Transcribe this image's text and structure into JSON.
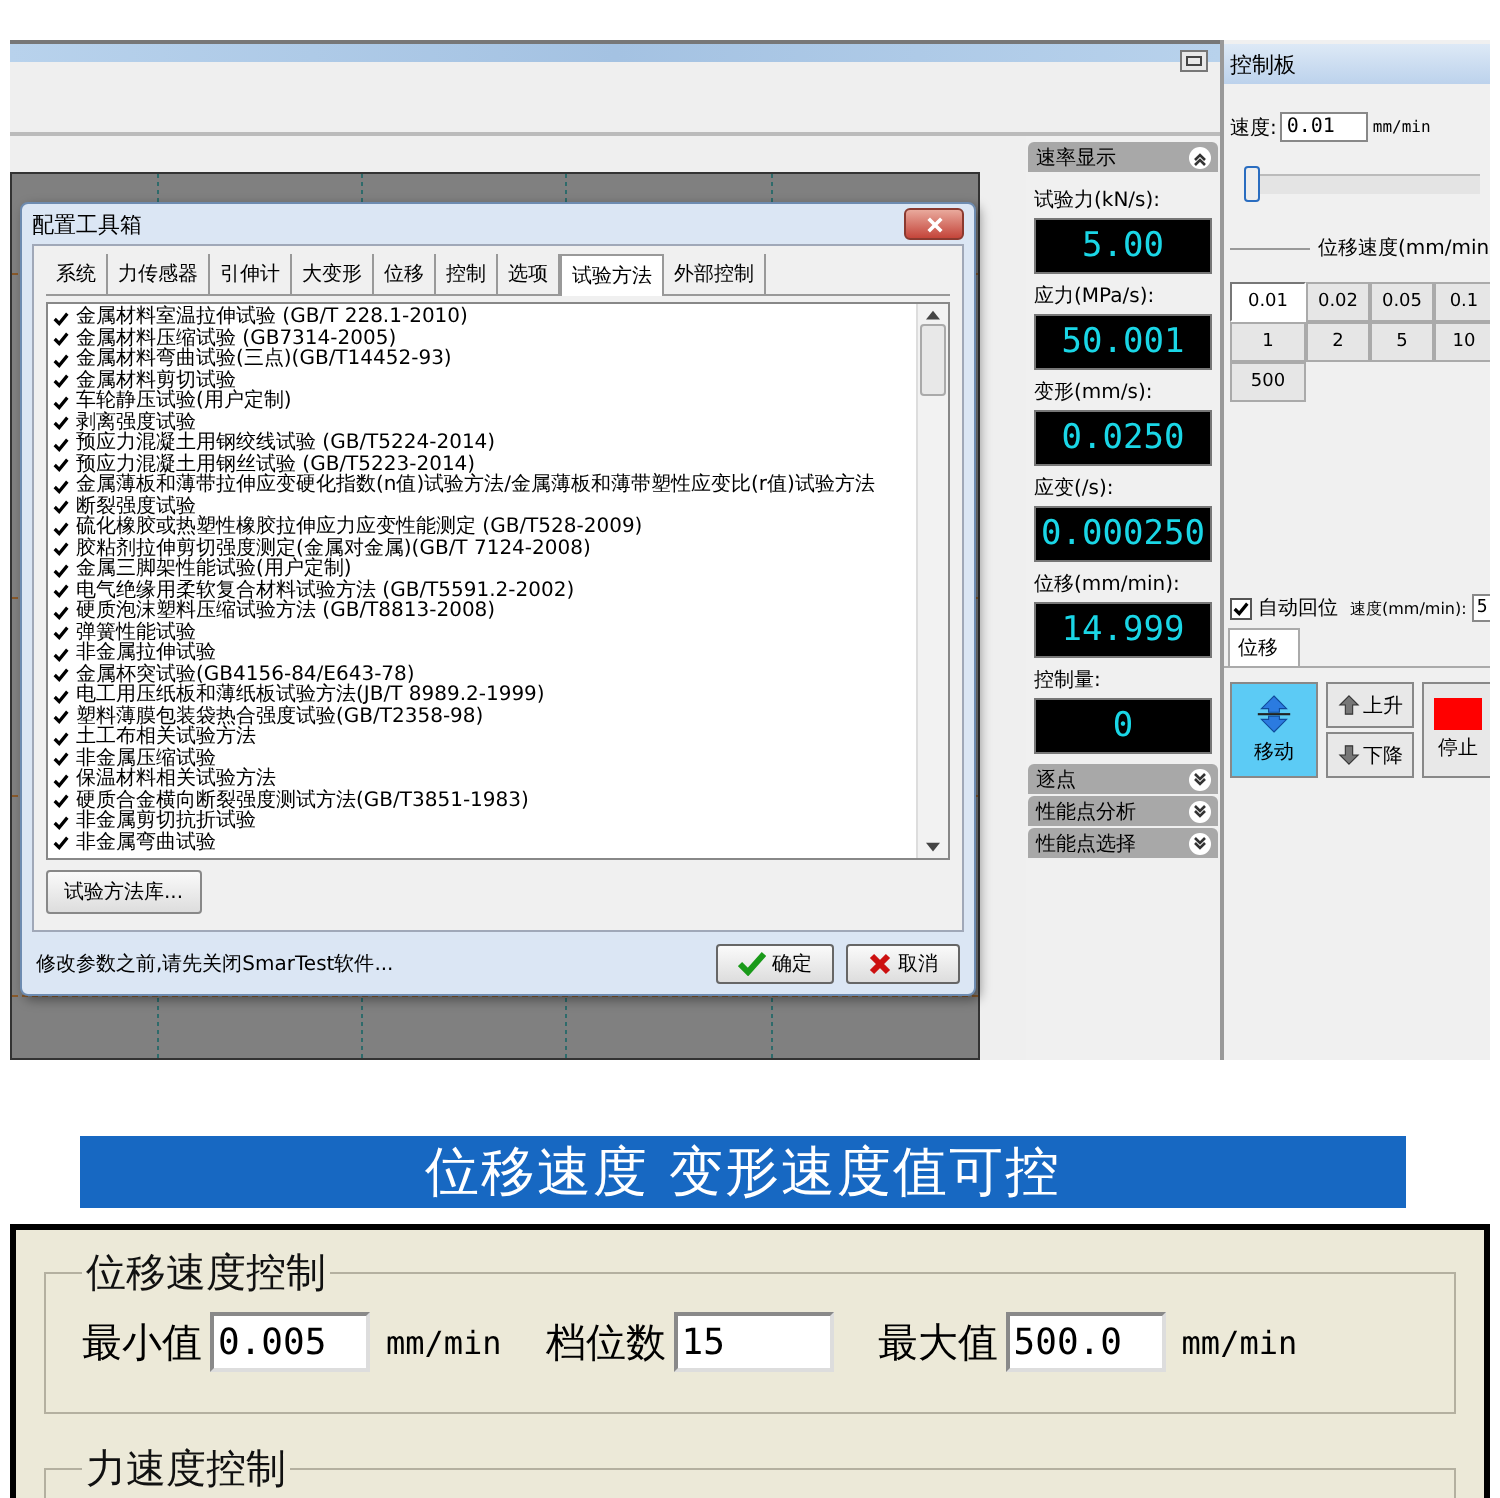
{
  "config_dialog": {
    "title": "配置工具箱",
    "tabs": [
      {
        "label": "系统",
        "selected": false
      },
      {
        "label": "力传感器",
        "selected": false
      },
      {
        "label": "引伸计",
        "selected": false
      },
      {
        "label": "大变形",
        "selected": false
      },
      {
        "label": "位移",
        "selected": false
      },
      {
        "label": "控制",
        "selected": false
      },
      {
        "label": "选项",
        "selected": false
      },
      {
        "label": "试验方法",
        "selected": true
      },
      {
        "label": "外部控制",
        "selected": false
      }
    ],
    "methods": [
      {
        "label": "金属材料室温拉伸试验 (GB/T 228.1-2010)",
        "checked": true
      },
      {
        "label": "金属材料压缩试验 (GB7314-2005)",
        "checked": true
      },
      {
        "label": "金属材料弯曲试验(三点)(GB/T14452-93)",
        "checked": true
      },
      {
        "label": "金属材料剪切试验",
        "checked": true
      },
      {
        "label": "车轮静压试验(用户定制)",
        "checked": true
      },
      {
        "label": "剥离强度试验",
        "checked": true
      },
      {
        "label": "预应力混凝土用钢绞线试验 (GB/T5224-2014)",
        "checked": true
      },
      {
        "label": "预应力混凝土用钢丝试验 (GB/T5223-2014)",
        "checked": true
      },
      {
        "label": "金属薄板和薄带拉伸应变硬化指数(n值)试验方法/金属薄板和薄带塑性应变比(r值)试验方法",
        "checked": true
      },
      {
        "label": "断裂强度试验",
        "checked": true
      },
      {
        "label": "硫化橡胶或热塑性橡胶拉伸应力应变性能测定 (GB/T528-2009)",
        "checked": true
      },
      {
        "label": "胶粘剂拉伸剪切强度测定(金属对金属)(GB/T 7124-2008)",
        "checked": true
      },
      {
        "label": "金属三脚架性能试验(用户定制)",
        "checked": true
      },
      {
        "label": "电气绝缘用柔软复合材料试验方法 (GB/T5591.2-2002)",
        "checked": true
      },
      {
        "label": "硬质泡沫塑料压缩试验方法 (GB/T8813-2008)",
        "checked": true
      },
      {
        "label": "弹簧性能试验",
        "checked": true
      },
      {
        "label": "非金属拉伸试验",
        "checked": true
      },
      {
        "label": "金属杯突试验(GB4156-84/E643-78)",
        "checked": true
      },
      {
        "label": "电工用压纸板和薄纸板试验方法(JB/T 8989.2-1999)",
        "checked": true
      },
      {
        "label": "塑料薄膜包装袋热合强度试验(GB/T2358-98)",
        "checked": true
      },
      {
        "label": "土工布相关试验方法",
        "checked": true
      },
      {
        "label": "非金属压缩试验",
        "checked": true
      },
      {
        "label": "保温材料相关试验方法",
        "checked": true
      },
      {
        "label": "硬质合金横向断裂强度测试方法(GB/T3851-1983)",
        "checked": true
      },
      {
        "label": "非金属剪切抗折试验",
        "checked": true
      },
      {
        "label": "非金属弯曲试验",
        "checked": true
      }
    ],
    "library_button": "试验方法库...",
    "status": "修改参数之前,请先关闭SmarTest软件...",
    "buttons": [
      {
        "kind": "ok",
        "label": "确定"
      },
      {
        "kind": "cancel",
        "label": "取消"
      }
    ]
  },
  "panels": [
    {
      "title": "速率显示",
      "expanded": true,
      "readouts": [
        {
          "label": "试验力(kN/s):",
          "value": "5.00"
        },
        {
          "label": "应力(MPa/s):",
          "value": "50.001"
        },
        {
          "label": "变形(mm/s):",
          "value": "0.0250"
        },
        {
          "label": "应变(/s):",
          "value": "0.000250"
        },
        {
          "label": "位移(mm/min):",
          "value": "14.999"
        },
        {
          "label": "控制量:",
          "value": "0"
        }
      ]
    },
    {
      "title": "逐点",
      "expanded": false
    },
    {
      "title": "性能点分析",
      "expanded": false
    },
    {
      "title": "性能点选择",
      "expanded": false
    }
  ],
  "control_panel": {
    "title": "控制板",
    "speed_label": "速度:",
    "speed_value": "0.01",
    "speed_unit": "mm/min",
    "slider": {
      "level": 0
    },
    "preset_heading": "位移速度(mm/min",
    "presets": [
      {
        "label": "0.01",
        "selected": true
      },
      {
        "label": "0.02",
        "selected": false
      },
      {
        "label": "0.05",
        "selected": false
      },
      {
        "label": "0.1",
        "selected": false
      },
      {
        "label": "1",
        "selected": false
      },
      {
        "label": "2",
        "selected": false
      },
      {
        "label": "5",
        "selected": false
      },
      {
        "label": "10",
        "selected": false
      },
      {
        "label": "500",
        "selected": false
      }
    ],
    "auto_return": {
      "label": "自动回位",
      "checked": true
    },
    "return_speed_label": "速度(mm/min):",
    "return_speed_value": "5",
    "tab": {
      "label": "位移",
      "selected": true
    },
    "actions": [
      {
        "kind": "move",
        "label": "移动",
        "selected": true
      },
      {
        "kind": "up",
        "label": "上升",
        "selected": false
      },
      {
        "kind": "down",
        "label": "下降",
        "selected": false
      },
      {
        "kind": "stop",
        "label": "停止",
        "selected": false
      }
    ]
  },
  "banner": "位移速度 变形速度值可控",
  "speed_settings": {
    "groups": [
      {
        "title": "位移速度控制",
        "fields": [
          {
            "label": "最小值",
            "value": "0.005",
            "unit": "mm/min"
          },
          {
            "label": "档位数",
            "value": "15"
          },
          {
            "label": "最大值",
            "value": "500.0",
            "unit": "mm/min"
          }
        ]
      },
      {
        "title": "力速度控制"
      }
    ]
  }
}
